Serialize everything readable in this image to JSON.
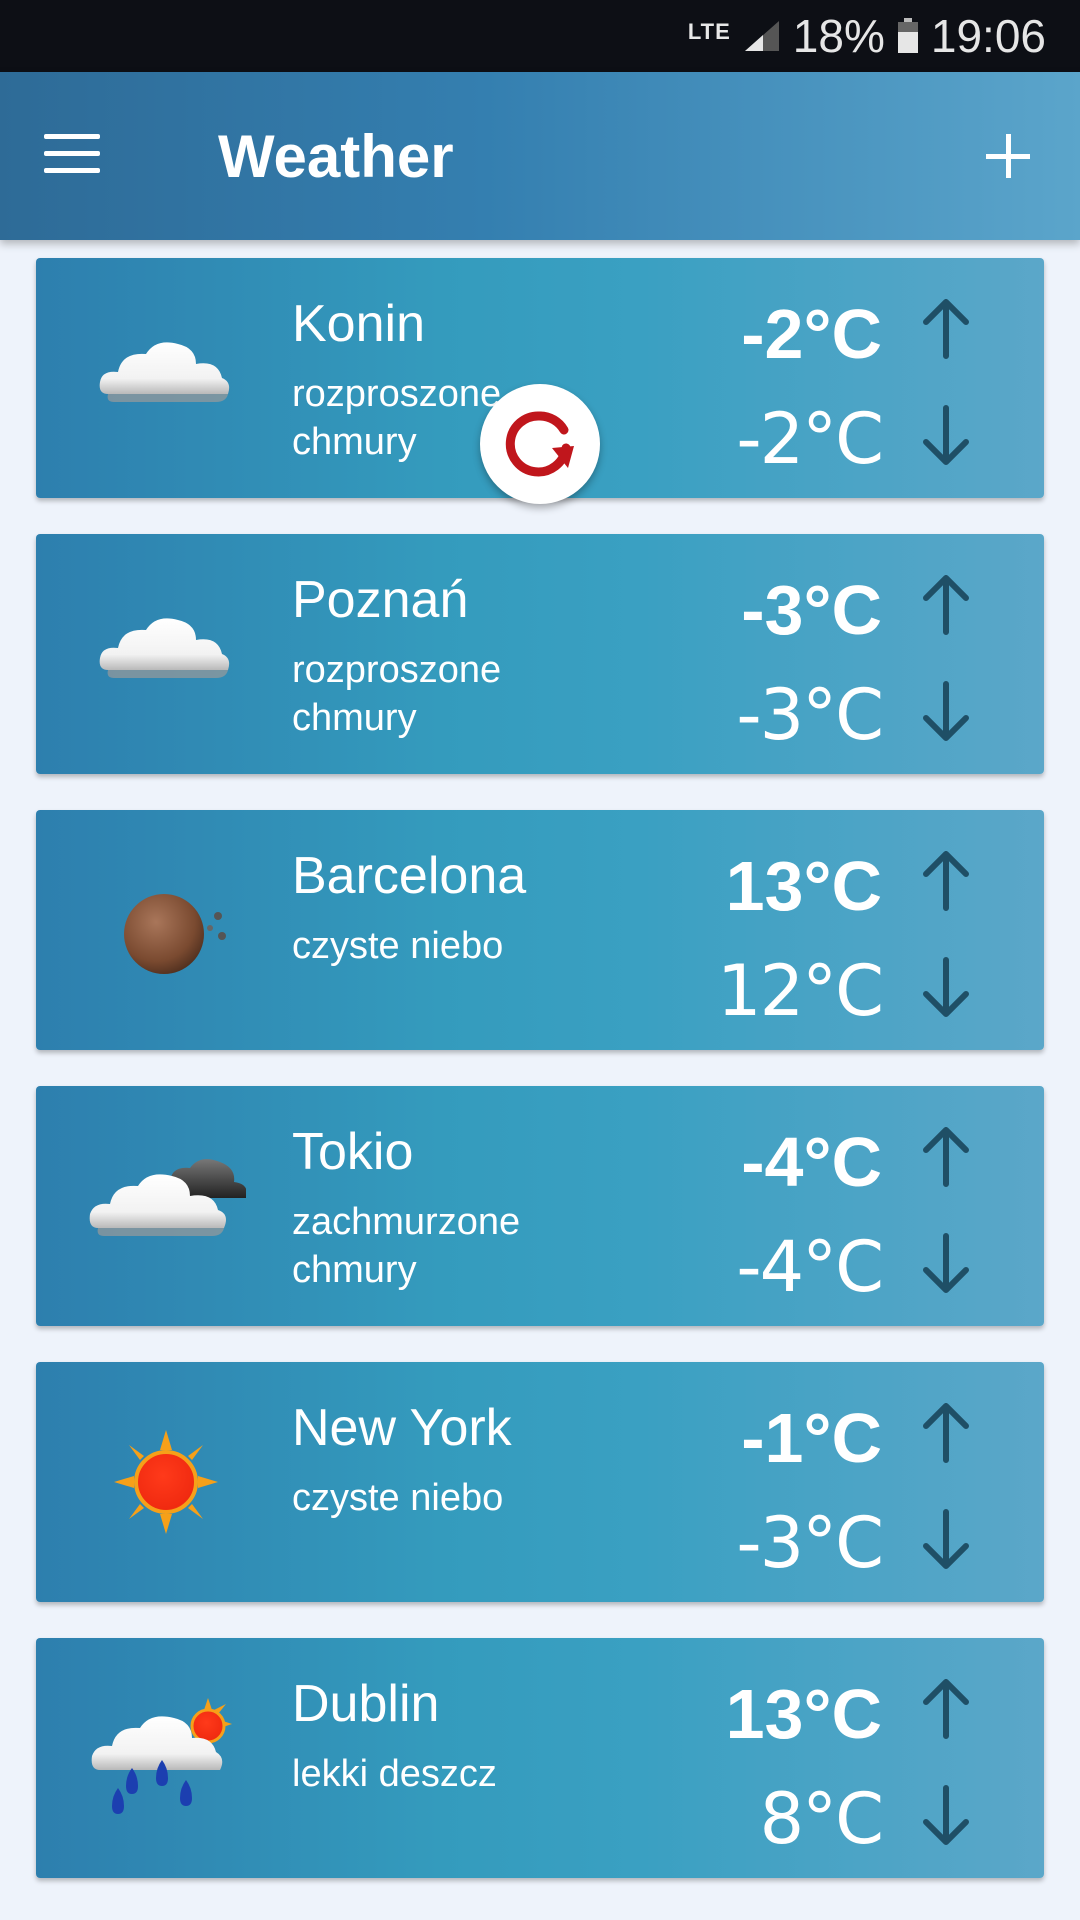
{
  "status_bar": {
    "network": "LTE",
    "battery_percent": "18%",
    "time": "19:06"
  },
  "app_bar": {
    "title": "Weather",
    "menu_icon": "hamburger-menu-icon",
    "add_icon": "plus-icon"
  },
  "refresh_icon": "refresh-icon",
  "cities": [
    {
      "name": "Konin",
      "description": "rozproszone chmury",
      "temp_max": "-2°C",
      "temp_min": "-2°C",
      "icon": "cloud-icon"
    },
    {
      "name": "Poznań",
      "description": "rozproszone chmury",
      "temp_max": "-3°C",
      "temp_min": "-3°C",
      "icon": "cloud-icon"
    },
    {
      "name": "Barcelona",
      "description": "czyste niebo",
      "temp_max": "13°C",
      "temp_min": "12°C",
      "icon": "night-moon-icon"
    },
    {
      "name": "Tokio",
      "description": "zachmurzone chmury",
      "temp_max": "-4°C",
      "temp_min": "-4°C",
      "icon": "overcast-clouds-icon"
    },
    {
      "name": "New York",
      "description": "czyste niebo",
      "temp_max": "-1°C",
      "temp_min": "-3°C",
      "icon": "sun-icon"
    },
    {
      "name": "Dublin",
      "description": "lekki deszcz",
      "temp_max": "13°C",
      "temp_min": "8°C",
      "icon": "light-rain-icon"
    }
  ],
  "colors": {
    "app_bar": "#347fb0",
    "card": "#349bbd",
    "arrow": "#1f4f66",
    "refresh": "#c0161c"
  }
}
